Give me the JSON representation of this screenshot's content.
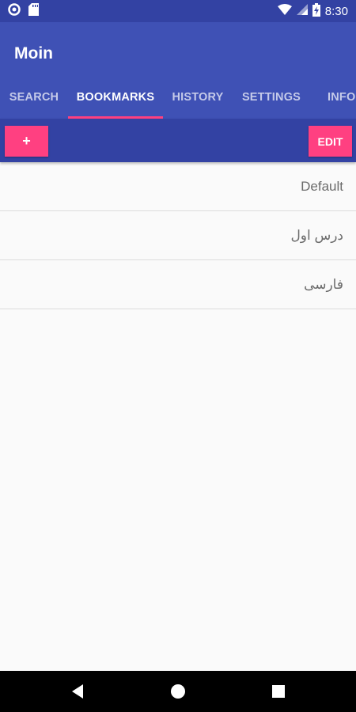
{
  "status_bar": {
    "time": "8:30",
    "icons": [
      "circle-notification-icon",
      "sd-card-icon",
      "wifi-icon",
      "signal-icon",
      "battery-charging-icon"
    ]
  },
  "app_bar": {
    "title": "Moin",
    "tabs": [
      {
        "label": "SEARCH",
        "active": false
      },
      {
        "label": "BOOKMARKS",
        "active": true
      },
      {
        "label": "HISTORY",
        "active": false
      },
      {
        "label": "SETTINGS",
        "active": false
      },
      {
        "label": "INFO",
        "active": false
      }
    ]
  },
  "toolbar": {
    "add_label": "+",
    "edit_label": "EDIT"
  },
  "bookmarks": [
    {
      "label": "Default"
    },
    {
      "label": "درس اول"
    },
    {
      "label": "فارسی"
    }
  ],
  "nav_bar": {
    "icons": [
      "back-icon",
      "home-icon",
      "recents-icon"
    ]
  },
  "colors": {
    "primary": "#3f51b5",
    "primary_dark": "#3342a3",
    "accent": "#ff4081"
  }
}
